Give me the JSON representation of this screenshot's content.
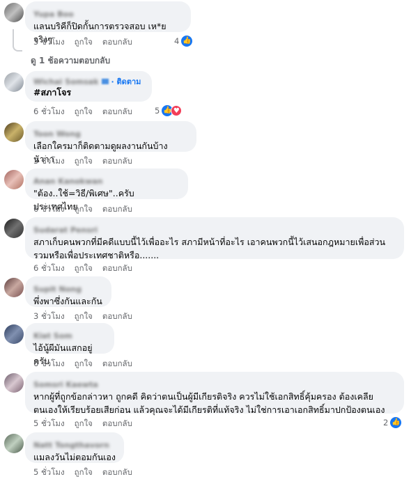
{
  "labels": {
    "like": "ถูกใจ",
    "reply": "ตอบกลับ",
    "follow": "ติดตาม"
  },
  "view_replies": "ดู 1 ช้อความตอบกลับ",
  "comments": [
    {
      "name": "Yupa Boo",
      "text": "แลนบริคีก็ปิดกั้นการตรวจสอบ เห*ยจริงๆ",
      "time": "5 ชั่วโมง",
      "reactions": "4"
    },
    {
      "name": "Wichai Somsak",
      "text": "#สภาโจร",
      "time": "6 ชั่วโมง",
      "reactions": "5"
    },
    {
      "name": "Toon Wong",
      "text": "เลือกใครมาก็ติดตามดูผลงานกันบ้างนัาาา",
      "time": "3 ชั่วโมง",
      "reactions": ""
    },
    {
      "name": "Anan Kanokwan",
      "text": "\"ต้อง..ใช้=วิธี/พิเศษ\"..ครับ ประเทศไทย",
      "time": "6 ชั่วโมง",
      "reactions": ""
    },
    {
      "name": "Sudarat Pensri",
      "text": "สภาเก็บคนพวกที่มีคดีแบบนี้ไว้เพื่ออะไร สภามีหน้าที่อะไร เอาคนพวกนี้ไว้เสนอกฎหมายเพื่อส่วน\nรวมหรือเพื่อประเทศชาติหรือ.......",
      "time": "6 ชั่วโมง",
      "reactions": ""
    },
    {
      "name": "Supit Nong",
      "text": "พึ่งพาซึ่งกันและกัน",
      "time": "3 ชั่วโมง",
      "reactions": ""
    },
    {
      "name": "Kiat Som",
      "text": "ไอ้นู้ผีมันแสกอยู่ครับ",
      "time": "6 ชั่วโมง",
      "reactions": ""
    },
    {
      "name": "Somsri Kaewta",
      "text": "หากผู้ที่ถูกข้อกล่าวหา ถูกคดี คิดว่าตนเป็นผู้มีเกียรติจริง ควรไม่ใช้เอกสิทธิ์คุ้มครอง ต้องเคลีย\nตนเองให้เรียบร้อยเสียก่อน แล้วคุณจะได้มีเกียรติที่แท้จริง ไม่ใช่การเอาเอกสิทธิ์มาปกป้องตนเอง",
      "time": "5 ชั่วโมง",
      "reactions": "2"
    },
    {
      "name": "Natt Tongthavorn",
      "text": "แมลงวันไม่ตอมกันเอง",
      "time": "5 ชั่วโมง",
      "reactions": ""
    }
  ]
}
